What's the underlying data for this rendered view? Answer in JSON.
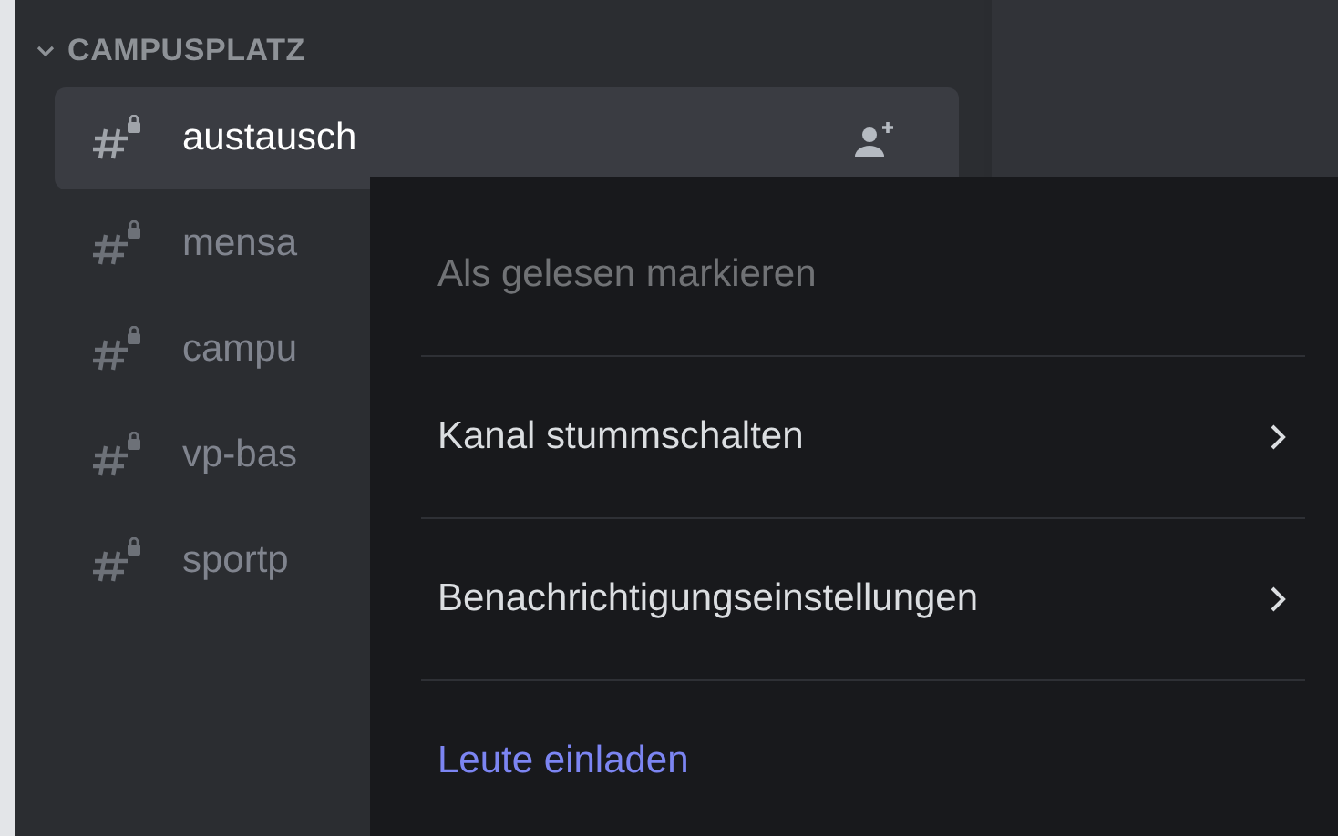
{
  "sidebar": {
    "category": {
      "label": "CAMPUSPLATZ",
      "expanded": true
    },
    "channels": [
      {
        "name": "austausch",
        "selected": true
      },
      {
        "name": "mensa",
        "selected": false
      },
      {
        "name": "campu",
        "selected": false
      },
      {
        "name": "vp-bas",
        "selected": false
      },
      {
        "name": "sportp",
        "selected": false
      }
    ]
  },
  "context_menu": {
    "items": [
      {
        "label": "Als gelesen markieren",
        "disabled": true,
        "submenu": false,
        "kind": "default"
      },
      {
        "label": "Kanal stummschalten",
        "disabled": false,
        "submenu": true,
        "kind": "default"
      },
      {
        "label": "Benachrichtigungseinstellungen",
        "disabled": false,
        "submenu": true,
        "kind": "default"
      },
      {
        "label": "Leute einladen",
        "disabled": false,
        "submenu": false,
        "kind": "brand"
      }
    ]
  }
}
